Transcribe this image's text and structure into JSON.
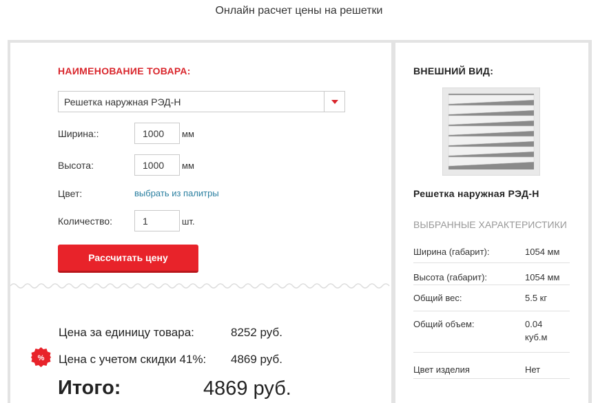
{
  "page": {
    "title": "Онлайн расчет цены на решетки"
  },
  "form": {
    "product_heading": "НАИМЕНОВАНИЕ ТОВАРА:",
    "product_select": {
      "value": "Решетка наружная РЭД-Н"
    },
    "width": {
      "label": "Ширина::",
      "value": "1000",
      "unit": "мм"
    },
    "height": {
      "label": "Высота:",
      "value": "1000",
      "unit": "мм"
    },
    "color": {
      "label": "Цвет:",
      "link": "выбрать из палитры"
    },
    "quantity": {
      "label": "Количество:",
      "value": "1",
      "unit": "шт."
    },
    "calc_button": "Рассчитать цену"
  },
  "pricing": {
    "unit_price_label": "Цена за единицу товара:",
    "unit_price_value": "8252 руб.",
    "discount_label": "Цена с учетом скидки 41%:",
    "discount_value": "4869 руб.",
    "discount_badge": "%",
    "total_label": "Итого:",
    "total_value": "4869 руб."
  },
  "preview": {
    "appearance_heading": "ВНЕШНИЙ ВИД:",
    "product_name": "Решетка наружная РЭД-Н",
    "characteristics_heading": "ВЫБРАННЫЕ ХАРАКТЕРИСТИКИ",
    "characteristics": [
      {
        "label": "Ширина (габарит):",
        "value": "1054 мм"
      },
      {
        "label": "Высота (габарит):",
        "value": "1054 мм"
      },
      {
        "label": "Общий вес:",
        "value": "5.5 кг"
      },
      {
        "label": "Общий объем:",
        "value": "0.04 куб.м"
      },
      {
        "label": "Цвет изделия",
        "value": "Нет"
      }
    ]
  },
  "colors": {
    "accent": "#e8232a",
    "heading_red": "#d9262c",
    "link": "#2a7fa0"
  }
}
